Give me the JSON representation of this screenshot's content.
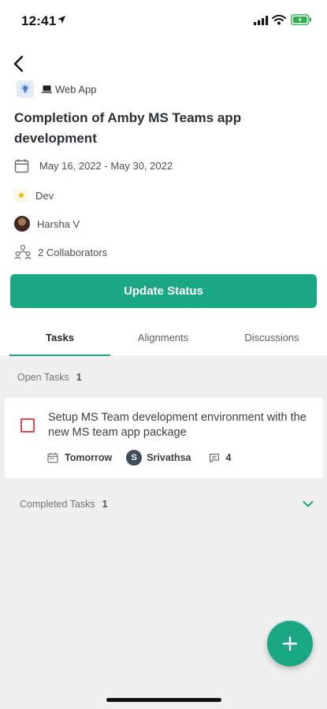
{
  "status_bar": {
    "time": "12:41"
  },
  "header": {
    "project_type": "Web App",
    "title": "Completion of Amby MS Teams app development",
    "date_range": "May 16, 2022 - May 30, 2022",
    "tag": "Dev",
    "owner": "Harsha V",
    "collaborators": "2 Collaborators"
  },
  "actions": {
    "update_status": "Update Status"
  },
  "tabs": [
    {
      "label": "Tasks",
      "active": true
    },
    {
      "label": "Alignments",
      "active": false
    },
    {
      "label": "Discussions",
      "active": false
    }
  ],
  "open_tasks": {
    "label": "Open Tasks",
    "count": "1",
    "items": [
      {
        "title": "Setup MS Team development environment with the new MS team app package",
        "due": "Tomorrow",
        "assignee_initial": "S",
        "assignee": "Srivathsa",
        "comments": "4"
      }
    ]
  },
  "completed_tasks": {
    "label": "Completed Tasks",
    "count": "1"
  },
  "colors": {
    "accent": "#1aa784",
    "checkbox_border": "#e24a4a",
    "background_tasks": "#f0f0f1"
  },
  "icons": [
    "location-arrow-icon",
    "signal-icon",
    "wifi-icon",
    "battery-icon",
    "back-arrow-icon",
    "lightbulb-icon",
    "laptop-icon",
    "calendar-icon",
    "collaborators-icon",
    "comment-icon",
    "chevron-down-icon",
    "plus-icon"
  ]
}
